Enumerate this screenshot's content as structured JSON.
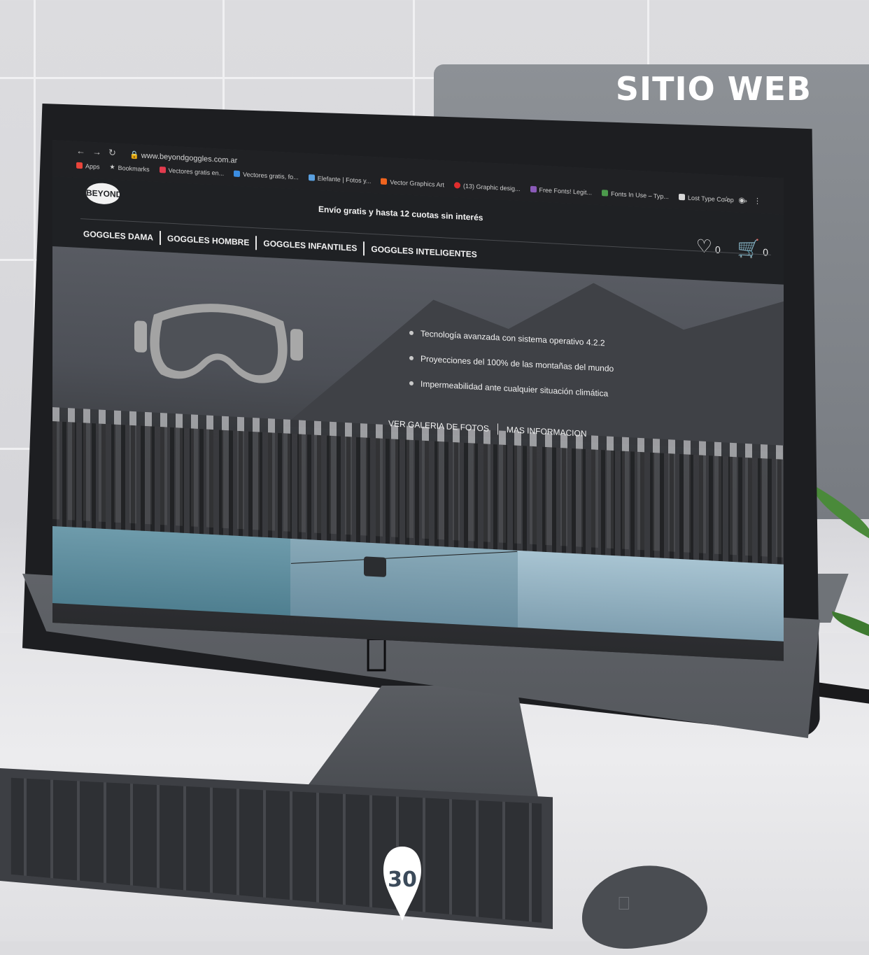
{
  "page": {
    "title": "SITIO WEB",
    "page_number": "30"
  },
  "browser": {
    "url": "www.beyondgoggles.com.ar",
    "bookmarks": [
      {
        "label": "Apps",
        "color": "#e8443a"
      },
      {
        "label": "Bookmarks",
        "color": "#d8d8d8"
      },
      {
        "label": "Vectores gratis en...",
        "color": "#e23b4e"
      },
      {
        "label": "Vectores gratis, fo...",
        "color": "#3b8de2"
      },
      {
        "label": "Elefante | Fotos y...",
        "color": "#5aa0e0"
      },
      {
        "label": "Vector Graphics Art",
        "color": "#f0641e"
      },
      {
        "label": "(13) Graphic desig...",
        "color": "#e02d2d"
      },
      {
        "label": "Free Fonts! Legit...",
        "color": "#8a5ab8"
      },
      {
        "label": "Fonts In Use – Typ...",
        "color": "#4c9a4c"
      },
      {
        "label": "Lost Type Co-op",
        "color": "#d8d8d8"
      }
    ],
    "more_bookmarks": "»"
  },
  "site": {
    "logo_text": "BEYOND",
    "promo": "Envío gratis y hasta 12 cuotas sin interés",
    "wishlist_count": "0",
    "cart_count": "0",
    "nav": [
      "GOGGLES DAMA",
      "GOGGLES HOMBRE",
      "GOGGLES INFANTILES",
      "GOGGLES INTELIGENTES"
    ],
    "features": [
      "Tecnología avanzada con sistema operativo 4.2.2",
      "Proyecciones del 100% de las montañas del mundo",
      "Impermeabilidad ante cualquier situación climática"
    ],
    "links": [
      "VER GALERIA DE FOTOS",
      "MAS INFORMACION"
    ]
  },
  "colors": {
    "screen_bg": "#1f2124",
    "accent_text": "#f2f2f2",
    "badge": "#3b4a5a"
  }
}
